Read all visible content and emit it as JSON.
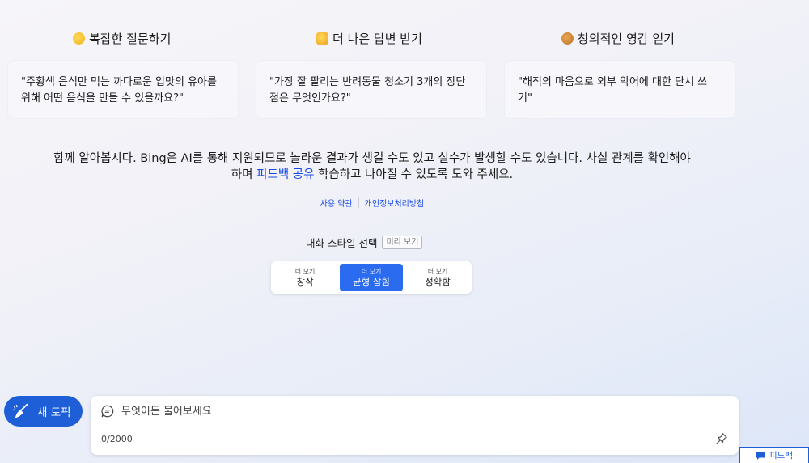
{
  "examples": [
    {
      "icon": "thinking-face-icon",
      "heading": "복잡한 질문하기",
      "text": "\"주황색 음식만 먹는 까다로운 입맛의 유아를 위해 어떤 음식을 만들 수 있을까요?\""
    },
    {
      "icon": "raising-hands-icon",
      "heading": "더 나은 답변 받기",
      "text": "\"가장 잘 팔리는 반려동물 청소기 3개의 장단점은 무엇인가요?\""
    },
    {
      "icon": "artist-palette-icon",
      "heading": "창의적인 영감 얻기",
      "text": "\"해적의 마음으로 외부 악어에 대한 단시 쓰기\""
    }
  ],
  "disclaimer": {
    "before": "함께 알아봅시다. Bing은 AI를 통해 지원되므로 놀라운 결과가 생길 수도 있고 실수가 발생할 수도 있습니다. 사실 관계를 확인해야 하며 ",
    "link": "피드백 공유",
    "after": " 학습하고 나아질 수 있도록 도와 주세요."
  },
  "links": {
    "terms": "사용 약관",
    "privacy": "개인정보처리방침"
  },
  "tone": {
    "label": "대화 스타일 선택",
    "badge": "미리 보기",
    "options": [
      {
        "more": "더 보기",
        "name": "창작",
        "active": false
      },
      {
        "more": "더 보기",
        "name": "균형 잡힘",
        "active": true
      },
      {
        "more": "더 보기",
        "name": "정확함",
        "active": false
      }
    ]
  },
  "new_topic": "새 토픽",
  "input": {
    "placeholder": "무엇이든 물어보세요",
    "value": "",
    "count": "0/2000"
  },
  "feedback": "피드백",
  "colors": {
    "accent": "#1e5fd8",
    "active_tone": "#2a6bf0",
    "link": "#174ae4"
  }
}
